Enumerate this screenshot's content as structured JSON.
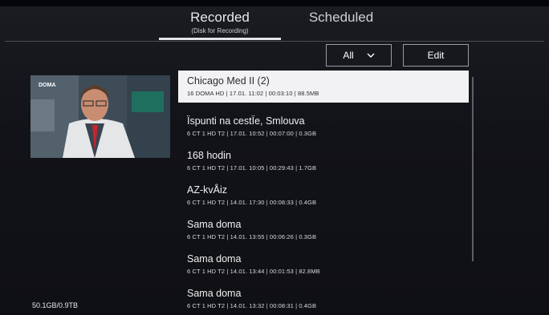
{
  "tabs": [
    {
      "label": "Recorded",
      "sublabel": "(Disk for Recording)",
      "active": true
    },
    {
      "label": "Scheduled",
      "active": false
    }
  ],
  "filter": {
    "selected": "All"
  },
  "edit_label": "Edit",
  "recordings": [
    {
      "title": "Chicago Med II (2)",
      "details": "16 DOMA HD | 17.01. 11:02 | 00:03:10 | 88.5MB",
      "selected": true
    },
    {
      "title": "Ïspunti na cestÏe, Smlouva",
      "details": "6 CT 1 HD T2 | 17.01. 10:52 | 00:07:00 | 0.3GB"
    },
    {
      "title": "168 hodin",
      "details": "6 CT 1 HD T2 | 17.01. 10:05 | 00:29:43 | 1.7GB"
    },
    {
      "title": "AZ-kvÅiz",
      "details": "6 CT 1 HD T2 | 14.01. 17:30 | 00:08:33 | 0.4GB"
    },
    {
      "title": "Sama doma",
      "details": "6 CT 1 HD T2 | 14.01. 13:55 | 00:06:26 | 0.3GB"
    },
    {
      "title": "Sama doma",
      "details": "6 CT 1 HD T2 | 14.01. 13:44 | 00:01:53 | 82.8MB"
    },
    {
      "title": "Sama doma",
      "details": "6 CT 1 HD T2 | 14.01. 13:32 | 00:08:31 | 0.4GB"
    }
  ],
  "storage": "50.1GB/0.9TB",
  "preview": {
    "channel_logo": "DOMA"
  },
  "colors": {
    "selected_bg": "#f2f2f4",
    "background": "#121318",
    "text": "#ffffff"
  }
}
